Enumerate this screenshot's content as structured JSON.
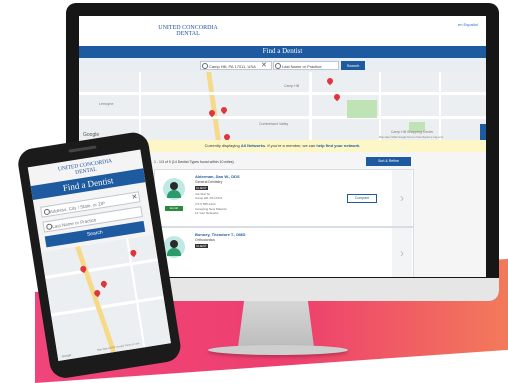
{
  "brand": {
    "line1": "UNITED CONCORDIA",
    "line2": "DENTAL"
  },
  "desktop": {
    "region_link": "en Español",
    "page_title": "Find a Dentist",
    "search": {
      "location_value": "Camp Hill, PA 17011, USA",
      "name_placeholder": "Last Name or Practice",
      "button": "Search"
    },
    "map": {
      "attribution": "Google",
      "footer": "Map data ©2022 Google   Terms of Use   Report a map error",
      "labels": [
        "Camp Hill",
        "Lemoyne",
        "Cumberland Valley",
        "Camp Hill Shopping Center"
      ]
    },
    "feedback": "Feedback",
    "notice": {
      "prefix": "Currently displaying",
      "network": "All Networks",
      "suffix": ". If you're a member, we can",
      "link": "help find your network."
    },
    "results_summary": "1 - 1/3 of 9 (14 Dentist Types found within 10 miles)",
    "sort_button": "Sort & Refine",
    "providers": [
      {
        "name": "Alderman, Dan W., DDS",
        "specialty": "General Dentistry",
        "badge": "CLIENT",
        "address": "4 E 21st St",
        "city": "Camp Hill, PA 17011",
        "phone": "(717) 555-1212",
        "status": "Accepting New Patients",
        "networks": "13 Your Networks",
        "enroll": "Enroll",
        "compare": "Compare"
      },
      {
        "name": "Bonney, Theodore T., DMD",
        "specialty": "Orthodontics",
        "badge": "CLIENT"
      }
    ]
  },
  "mobile": {
    "page_title": "Find a Dentist",
    "location_placeholder": "Address, City / State, or ZIP",
    "name_placeholder": "Last Name or Practice",
    "button": "Search",
    "map_footer": "Map data ©2022 Google   Terms of Use",
    "attribution": "Google"
  }
}
